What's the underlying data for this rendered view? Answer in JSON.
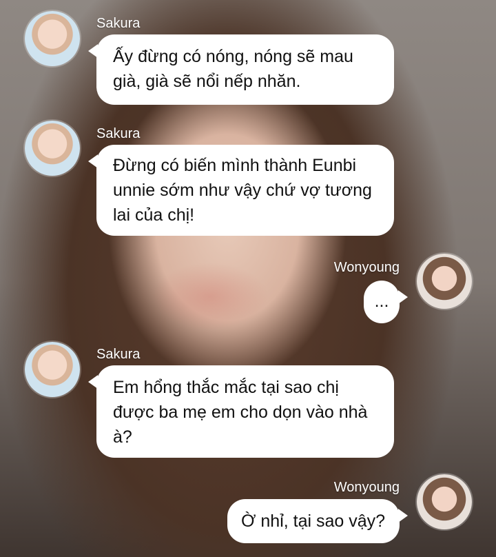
{
  "messages": [
    {
      "sender": "Sakura",
      "side": "left",
      "text": "Ấy đừng có nóng, nóng sẽ mau già, già sẽ nổi nếp nhăn."
    },
    {
      "sender": "Sakura",
      "side": "left",
      "text": "Đừng có biến mình thành Eunbi unnie sớm như vậy chứ vợ tương lai của chị!"
    },
    {
      "sender": "Wonyoung",
      "side": "right",
      "text": "..."
    },
    {
      "sender": "Sakura",
      "side": "left",
      "text": "Em hổng thắc mắc tại sao chị được ba mẹ em cho dọn vào nhà à?"
    },
    {
      "sender": "Wonyoung",
      "side": "right",
      "text": "Ờ nhỉ, tại sao vậy?"
    }
  ]
}
